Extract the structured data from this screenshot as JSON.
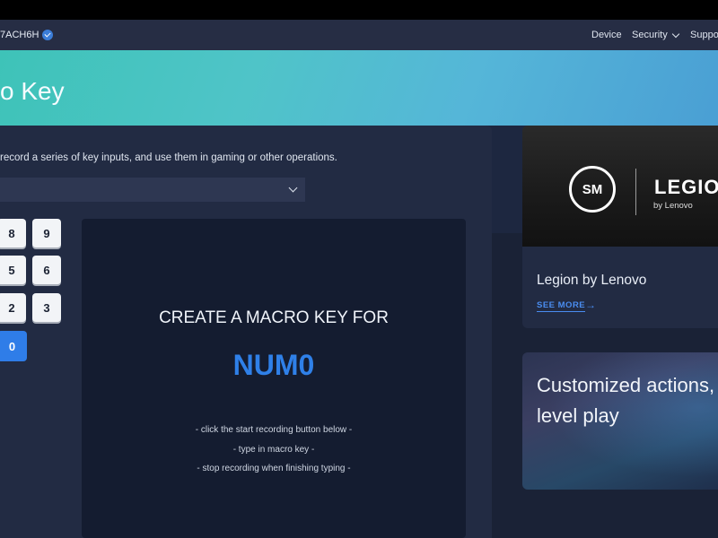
{
  "navbar": {
    "username": "7ACH6H",
    "links": {
      "device": "Device",
      "security": "Security",
      "support": "Suppo"
    }
  },
  "hero": {
    "title": "o Key"
  },
  "main": {
    "description": "record a series of key inputs, and use them in gaming or other operations.",
    "select_value": "",
    "keypad": {
      "k8": "8",
      "k9": "9",
      "k5": "5",
      "k6": "6",
      "k2": "2",
      "k3": "3",
      "k0": "0"
    },
    "macro": {
      "heading": "CREATE A MACRO KEY FOR",
      "key": "NUM0",
      "instructions": [
        "- click the start recording button below -",
        "- type in macro key -",
        "- stop recording when finishing typing -"
      ]
    }
  },
  "sidebar": {
    "card1": {
      "logo_text": "LEGIO",
      "logo_sub": "by Lenovo",
      "tsm_text": "SM",
      "title": "Legion by Lenovo",
      "see_more": "SEE MORE"
    },
    "card2": {
      "line1": "Customized actions,",
      "line2": "level play"
    }
  },
  "colors": {
    "accent": "#2f7de8",
    "link": "#4a8df0",
    "hero_start": "#3ec3b8",
    "hero_end": "#4a9fd4"
  }
}
